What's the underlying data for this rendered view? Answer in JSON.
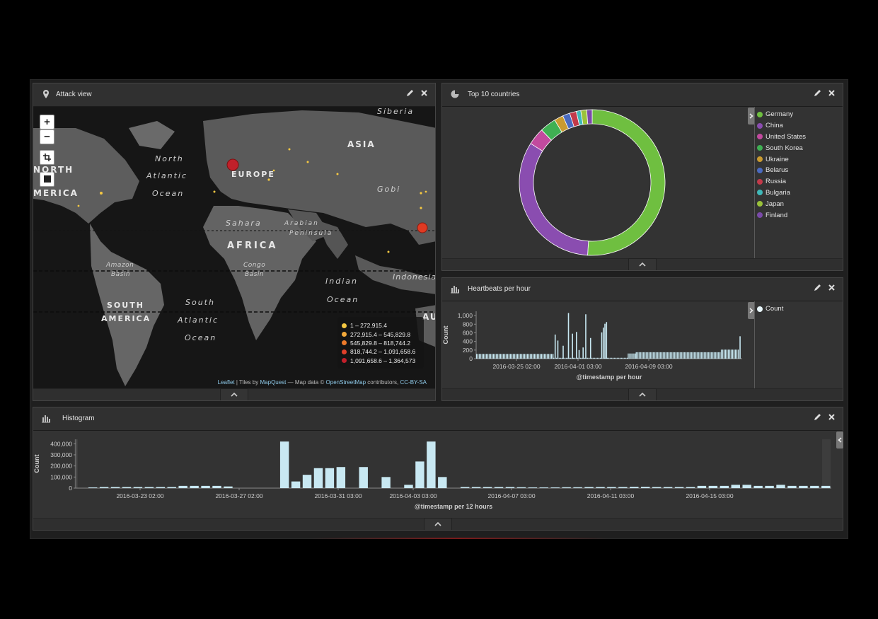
{
  "panels": {
    "map": {
      "title": "Attack view",
      "icon": "map-marker-icon",
      "zoom_in": "+",
      "zoom_out": "−",
      "labels": {
        "siberia": "Siberia",
        "asia": "ASIA",
        "north_atlantic_1": "North",
        "north_atlantic_2": "Atlantic",
        "north_atlantic_3": "Ocean",
        "north_america_1": "NORTH",
        "north_america_2": "MERICA",
        "europe": "EUROPE",
        "gobi": "Gobi",
        "sahara": "Sahara",
        "arabian_1": "Arabian",
        "arabian_2": "Peninsula",
        "africa": "AFRICA",
        "amazon_1": "Amazon",
        "amazon_2": "Basin",
        "congo_1": "Congo",
        "congo_2": "Basin",
        "indonesia": "Indonesia",
        "indian_1": "Indian",
        "indian_2": "Ocean",
        "south_america_1": "SOUTH",
        "south_america_2": "AMERICA",
        "south_atlantic_1": "South",
        "south_atlantic_2": "Atlantic",
        "south_atlantic_3": "Ocean",
        "australia": "AU"
      },
      "legend": [
        {
          "label": "1 – 272,915.4",
          "color": "#f5c842"
        },
        {
          "label": "272,915.4 – 545,829.8",
          "color": "#f3a93a"
        },
        {
          "label": "545,829.8 – 818,744.2",
          "color": "#ee7a2a"
        },
        {
          "label": "818,744.2 – 1,091,658.6",
          "color": "#e0402a"
        },
        {
          "label": "1,091,658.6 – 1,364,573",
          "color": "#c21f2a"
        }
      ],
      "attribution": {
        "leaflet": "Leaflet",
        "sep1": " | Tiles by ",
        "mapquest": "MapQuest",
        "sep2": " — Map data © ",
        "osm": "OpenStreetMap",
        "sep3": " contributors, ",
        "license": "CC-BY-SA"
      }
    },
    "countries": {
      "title": "Top 10 countries",
      "icon": "pie-chart-icon"
    },
    "heartbeats": {
      "title": "Heartbeats per hour",
      "icon": "bar-chart-icon"
    },
    "histogram": {
      "title": "Histogram",
      "icon": "bar-chart-icon"
    }
  },
  "chart_data": [
    {
      "id": "countries",
      "type": "pie",
      "donut": true,
      "categories": [
        "Germany",
        "China",
        "United States",
        "South Korea",
        "Ukraine",
        "Belarus",
        "Russia",
        "Bulgaria",
        "Japan",
        "Finland"
      ],
      "values": [
        51.0,
        33.0,
        3.8,
        3.6,
        2.0,
        1.6,
        1.5,
        1.0,
        1.3,
        1.2
      ],
      "colors": [
        "#6fbf40",
        "#8a4db0",
        "#c24a9e",
        "#3fb053",
        "#c99a30",
        "#4a6abf",
        "#c23a4a",
        "#3fb8b8",
        "#9ac23a",
        "#7a4aa8"
      ]
    },
    {
      "id": "heartbeats",
      "type": "bar",
      "xlabel": "@timestamp per hour",
      "ylabel": "Count",
      "ylim": [
        0,
        1100
      ],
      "yticks": [
        "0",
        "200",
        "400",
        "600",
        "800",
        "1,000"
      ],
      "xticks": [
        "2016-03-25 02:00",
        "2016-04-01 03:00",
        "2016-04-09 03:00"
      ],
      "series": [
        {
          "name": "Count",
          "color": "#c8e8f2"
        }
      ],
      "segments": [
        {
          "from": 0,
          "to": 0.29,
          "value": 110
        },
        {
          "from": 0.29,
          "to": 0.57,
          "value": 20
        },
        {
          "from": 0.57,
          "to": 0.6,
          "value": 120
        },
        {
          "from": 0.6,
          "to": 0.92,
          "value": 150
        },
        {
          "from": 0.92,
          "to": 0.985,
          "value": 210
        }
      ],
      "spikes": [
        {
          "at": 0.295,
          "value": 560
        },
        {
          "at": 0.305,
          "value": 420
        },
        {
          "at": 0.325,
          "value": 300
        },
        {
          "at": 0.345,
          "value": 1060
        },
        {
          "at": 0.36,
          "value": 580
        },
        {
          "at": 0.375,
          "value": 620
        },
        {
          "at": 0.385,
          "value": 200
        },
        {
          "at": 0.4,
          "value": 260
        },
        {
          "at": 0.41,
          "value": 1030
        },
        {
          "at": 0.428,
          "value": 480
        },
        {
          "at": 0.47,
          "value": 610
        },
        {
          "at": 0.476,
          "value": 720
        },
        {
          "at": 0.482,
          "value": 810
        },
        {
          "at": 0.488,
          "value": 850
        },
        {
          "at": 0.99,
          "value": 520
        }
      ],
      "legend": "Count"
    },
    {
      "id": "histogram",
      "type": "bar",
      "xlabel": "@timestamp per 12 hours",
      "ylabel": "Count",
      "ylim": [
        0,
        440000
      ],
      "yticks": [
        "0",
        "100,000",
        "200,000",
        "300,000",
        "400,000"
      ],
      "xticks": [
        "2016-03-23 02:00",
        "2016-03-27 02:00",
        "2016-03-31 03:00",
        "2016-04-03 03:00",
        "2016-04-07 03:00",
        "2016-04-11 03:00",
        "2016-04-15 03:00"
      ],
      "series": [
        {
          "name": "Count",
          "color": "#c8e8f2"
        }
      ],
      "values": [
        0,
        2000,
        10000,
        10000,
        10000,
        10000,
        10000,
        10000,
        10000,
        20000,
        20000,
        20000,
        20000,
        15000,
        0,
        0,
        0,
        0,
        420000,
        60000,
        120000,
        180000,
        180000,
        190000,
        0,
        190000,
        0,
        100000,
        0,
        30000,
        240000,
        420000,
        100000,
        0,
        10000,
        10000,
        10000,
        10000,
        10000,
        8000,
        6000,
        6000,
        6000,
        8000,
        8000,
        10000,
        10000,
        10000,
        10000,
        12000,
        12000,
        10000,
        10000,
        10000,
        10000,
        20000,
        20000,
        20000,
        30000,
        30000,
        20000,
        20000,
        30000,
        20000,
        20000,
        20000,
        20000
      ]
    }
  ]
}
